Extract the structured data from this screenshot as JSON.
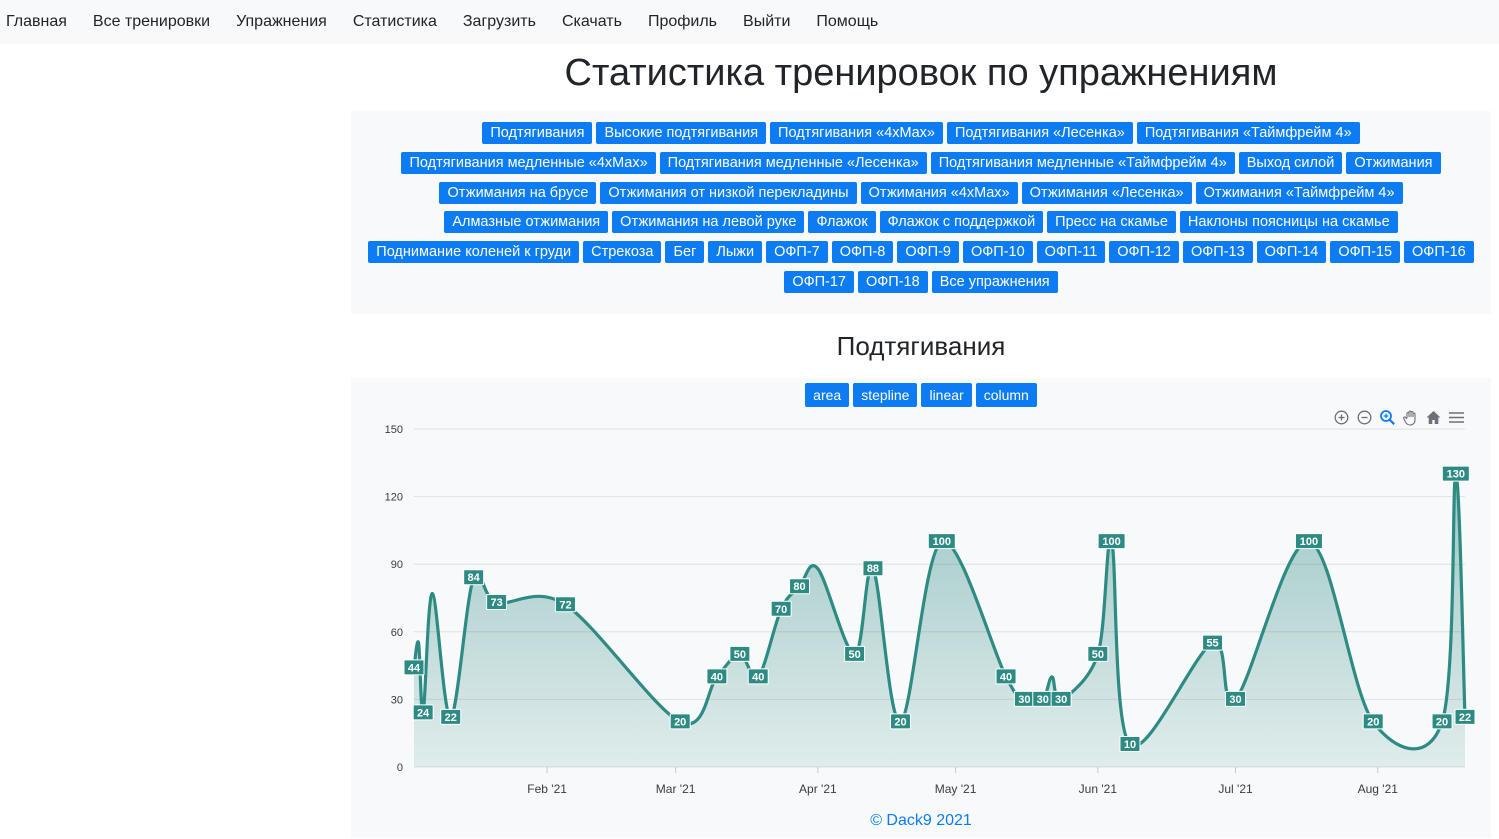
{
  "nav": [
    "Главная",
    "Все тренировки",
    "Упражнения",
    "Статистика",
    "Загрузить",
    "Скачать",
    "Профиль",
    "Выйти",
    "Помощь"
  ],
  "page_title": "Статистика тренировок по упражнениям",
  "exercises": [
    "Подтягивания",
    "Высокие подтягивания",
    "Подтягивания «4xMax»",
    "Подтягивания «Лесенка»",
    "Подтягивания «Таймфрейм 4»",
    "Подтягивания медленные «4xMax»",
    "Подтягивания медленные «Лесенка»",
    "Подтягивания медленные «Таймфрейм 4»",
    "Выход силой",
    "Отжимания",
    "Отжимания на брусе",
    "Отжимания от низкой перекладины",
    "Отжимания «4xMax»",
    "Отжимания «Лесенка»",
    "Отжимания «Таймфрейм 4»",
    "Алмазные отжимания",
    "Отжимания на левой руке",
    "Флажок",
    "Флажок с поддержкой",
    "Пресс на скамье",
    "Наклоны поясницы на скамье",
    "Поднимание коленей к груди",
    "Стрекоза",
    "Бег",
    "Лыжи",
    "ОФП-7",
    "ОФП-8",
    "ОФП-9",
    "ОФП-10",
    "ОФП-11",
    "ОФП-12",
    "ОФП-13",
    "ОФП-14",
    "ОФП-15",
    "ОФП-16",
    "ОФП-17",
    "ОФП-18",
    "Все упражнения"
  ],
  "chart_title": "Подтягивания",
  "chart_types": [
    "area",
    "stepline",
    "linear",
    "column"
  ],
  "toolbar_icons": [
    "zoom-in-icon",
    "zoom-out-icon",
    "selection-zoom-icon",
    "pan-hand-icon",
    "home-reset-icon",
    "menu-icon"
  ],
  "footer": "© Dack9 2021",
  "colors": {
    "accent": "#0d7cf2",
    "series": "#2e8b84",
    "panel": "#f8f9fa"
  },
  "chart_data": {
    "type": "area",
    "curve": "smooth",
    "title": "Подтягивания",
    "xlabel": "",
    "ylabel": "",
    "x": [
      "2021-01-03",
      "2021-01-05",
      "2021-01-08",
      "2021-01-11",
      "2021-01-16",
      "2021-01-20",
      "2021-02-05",
      "2021-02-28",
      "2021-03-08",
      "2021-03-12",
      "2021-03-16",
      "2021-03-21",
      "2021-03-25",
      "2021-03-30",
      "2021-04-08",
      "2021-04-13",
      "2021-04-17",
      "2021-04-26",
      "2021-05-09",
      "2021-05-15",
      "2021-05-19",
      "2021-05-23",
      "2021-05-30",
      "2021-06-06",
      "2021-06-19",
      "2021-06-24",
      "2021-07-11",
      "2021-07-22",
      "2021-08-06",
      "2021-08-16",
      "2021-08-22",
      "2021-08-27"
    ],
    "values": [
      44,
      24,
      77,
      22,
      84,
      73,
      72,
      20,
      40,
      50,
      40,
      70,
      80,
      88,
      50,
      88,
      20,
      100,
      40,
      30,
      30,
      40,
      30,
      50,
      100,
      10,
      55,
      30,
      100,
      20,
      20,
      130,
      22
    ],
    "point_labels": [
      44,
      24,
      22,
      84,
      73,
      72,
      20,
      40,
      50,
      40,
      70,
      80,
      50,
      88,
      20,
      100,
      40,
      30,
      30,
      30,
      50,
      100,
      10,
      55,
      30,
      100,
      20,
      20,
      130,
      22
    ],
    "x_ticks": [
      "Feb '21",
      "Mar '21",
      "Apr '21",
      "May '21",
      "Jun '21",
      "Jul '21",
      "Aug '21"
    ],
    "y_ticks": [
      0,
      30,
      60,
      90,
      120,
      150
    ],
    "ylim": [
      0,
      150
    ],
    "grid": true,
    "legend": "none"
  },
  "series_points": [
    {
      "date": "2021-01-03",
      "value": 44,
      "label": true
    },
    {
      "date": "2021-01-04",
      "value": 55,
      "label": false
    },
    {
      "date": "2021-01-05",
      "value": 24,
      "label": true
    },
    {
      "date": "2021-01-07",
      "value": 77,
      "label": false
    },
    {
      "date": "2021-01-11",
      "value": 22,
      "label": true
    },
    {
      "date": "2021-01-16",
      "value": 84,
      "label": true
    },
    {
      "date": "2021-01-21",
      "value": 73,
      "label": true
    },
    {
      "date": "2021-02-05",
      "value": 72,
      "label": true
    },
    {
      "date": "2021-03-02",
      "value": 20,
      "label": true
    },
    {
      "date": "2021-03-10",
      "value": 40,
      "label": true
    },
    {
      "date": "2021-03-15",
      "value": 50,
      "label": true
    },
    {
      "date": "2021-03-19",
      "value": 40,
      "label": true
    },
    {
      "date": "2021-03-24",
      "value": 70,
      "label": true
    },
    {
      "date": "2021-03-28",
      "value": 80,
      "label": true
    },
    {
      "date": "2021-04-01",
      "value": 88,
      "label": false
    },
    {
      "date": "2021-04-09",
      "value": 50,
      "label": true
    },
    {
      "date": "2021-04-13",
      "value": 88,
      "label": true
    },
    {
      "date": "2021-04-19",
      "value": 20,
      "label": true
    },
    {
      "date": "2021-04-28",
      "value": 100,
      "label": true
    },
    {
      "date": "2021-05-12",
      "value": 40,
      "label": true
    },
    {
      "date": "2021-05-16",
      "value": 30,
      "label": true
    },
    {
      "date": "2021-05-20",
      "value": 30,
      "label": true
    },
    {
      "date": "2021-05-22",
      "value": 40,
      "label": false
    },
    {
      "date": "2021-05-24",
      "value": 30,
      "label": true
    },
    {
      "date": "2021-06-01",
      "value": 50,
      "label": true
    },
    {
      "date": "2021-06-04",
      "value": 100,
      "label": true
    },
    {
      "date": "2021-06-08",
      "value": 10,
      "label": true
    },
    {
      "date": "2021-06-26",
      "value": 55,
      "label": true
    },
    {
      "date": "2021-07-01",
      "value": 30,
      "label": true
    },
    {
      "date": "2021-07-17",
      "value": 100,
      "label": true
    },
    {
      "date": "2021-07-31",
      "value": 20,
      "label": true
    },
    {
      "date": "2021-08-15",
      "value": 20,
      "label": true
    },
    {
      "date": "2021-08-18",
      "value": 130,
      "label": true
    },
    {
      "date": "2021-08-20",
      "value": 22,
      "label": true
    }
  ]
}
